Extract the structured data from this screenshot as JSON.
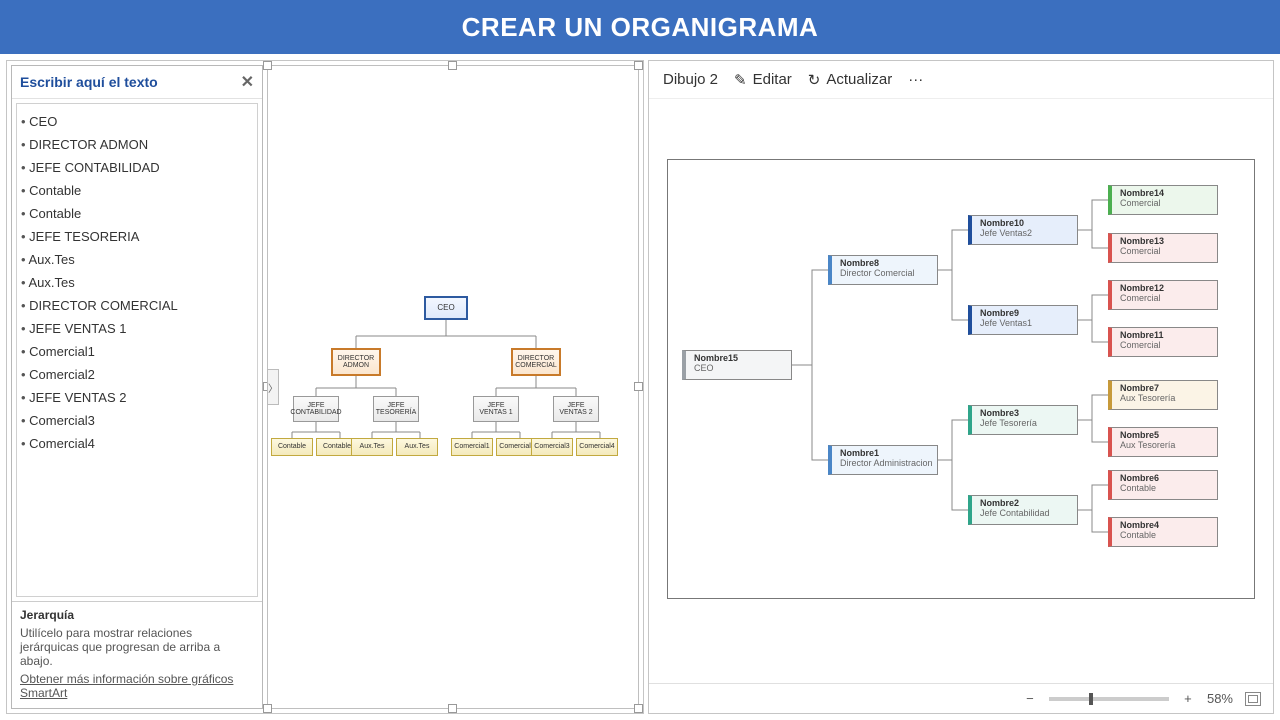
{
  "header": {
    "title": "CREAR UN ORGANIGRAMA"
  },
  "textPanel": {
    "heading": "Escribir aquí el texto",
    "close": "✕",
    "items": [
      {
        "lvl": 0,
        "text": "CEO"
      },
      {
        "lvl": 1,
        "text": "DIRECTOR ADMON"
      },
      {
        "lvl": 2,
        "text": "JEFE CONTABILIDAD"
      },
      {
        "lvl": 3,
        "text": "Contable"
      },
      {
        "lvl": 3,
        "text": "Contable"
      },
      {
        "lvl": 2,
        "text": "JEFE TESORERIA"
      },
      {
        "lvl": 3,
        "text": "Aux.Tes"
      },
      {
        "lvl": 3,
        "text": "Aux.Tes"
      },
      {
        "lvl": 1,
        "text": "DIRECTOR COMERCIAL"
      },
      {
        "lvl": 2,
        "text": "JEFE VENTAS 1"
      },
      {
        "lvl": 3,
        "text": "Comercial1"
      },
      {
        "lvl": 3,
        "text": "Comercial2"
      },
      {
        "lvl": 2,
        "text": "JEFE VENTAS 2"
      },
      {
        "lvl": 3,
        "text": "Comercial3"
      },
      {
        "lvl": 3,
        "text": "Comercial4"
      }
    ],
    "footer": {
      "title": "Jerarquía",
      "desc": "Utilícelo para mostrar relaciones jerárquicas que progresan de arriba a abajo.",
      "link": "Obtener más información sobre gráficos SmartArt"
    }
  },
  "smartart": {
    "ceo": "CEO",
    "dir1": "DIRECTOR ADMON",
    "dir2": "DIRECTOR COMERCIAL",
    "j1": "JEFE CONTABILIDAD",
    "j2": "JEFE TESORERÍA",
    "j3": "JEFE VENTAS 1",
    "j4": "JEFE VENTAS 2",
    "leaves": [
      "Contable",
      "Contable",
      "Aux.Tes",
      "Aux.Tes",
      "Comercial1",
      "Comercial2",
      "Comercial3",
      "Comercial4"
    ]
  },
  "rightToolbar": {
    "name": "Dibujo 2",
    "edit": "Editar",
    "refresh": "Actualizar",
    "more": "···"
  },
  "rightDiagram": {
    "ceo": {
      "name": "Nombre15",
      "role": "CEO"
    },
    "dcom": {
      "name": "Nombre8",
      "role": "Director Comercial"
    },
    "dadm": {
      "name": "Nombre1",
      "role": "Director Administracion"
    },
    "jv2": {
      "name": "Nombre10",
      "role": "Jefe Ventas2"
    },
    "jv1": {
      "name": "Nombre9",
      "role": "Jefe Ventas1"
    },
    "jtes": {
      "name": "Nombre3",
      "role": "Jefe Tesorería"
    },
    "jcon": {
      "name": "Nombre2",
      "role": "Jefe Contabilidad"
    },
    "c14": {
      "name": "Nombre14",
      "role": "Comercial"
    },
    "c13": {
      "name": "Nombre13",
      "role": "Comercial"
    },
    "c12": {
      "name": "Nombre12",
      "role": "Comercial"
    },
    "c11": {
      "name": "Nombre11",
      "role": "Comercial"
    },
    "c7": {
      "name": "Nombre7",
      "role": "Aux Tesorería"
    },
    "c5": {
      "name": "Nombre5",
      "role": "Aux Tesorería"
    },
    "c6": {
      "name": "Nombre6",
      "role": "Contable"
    },
    "c4": {
      "name": "Nombre4",
      "role": "Contable"
    }
  },
  "zoom": {
    "minus": "−",
    "plus": "+",
    "value": "58%"
  }
}
